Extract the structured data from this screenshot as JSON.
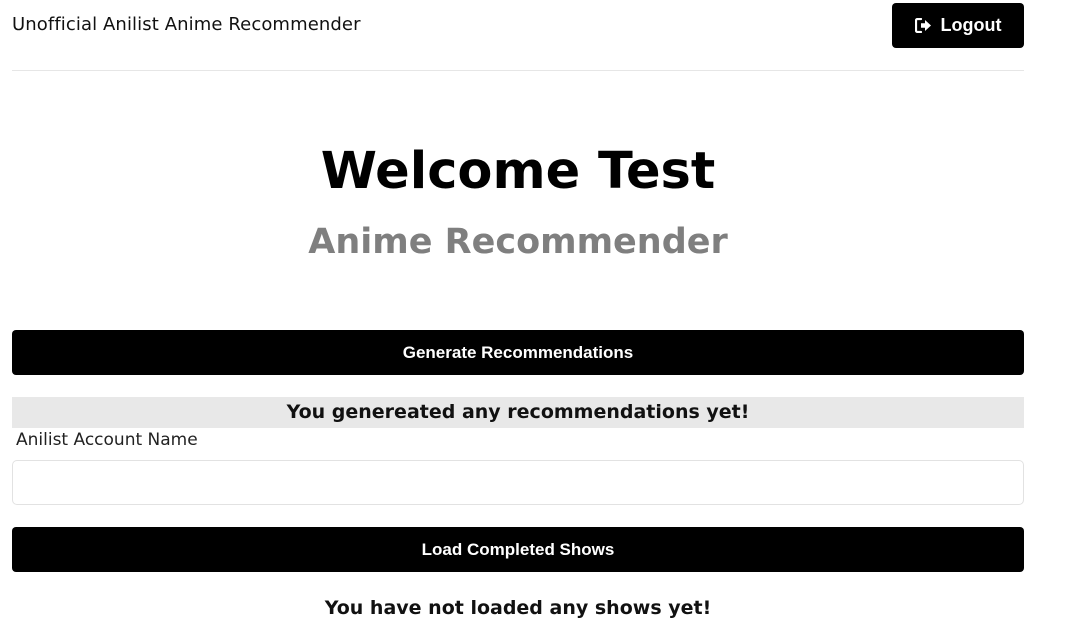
{
  "header": {
    "brand": "Unofficial Anilist Anime Recommender",
    "logout_label": "Logout",
    "logout_icon": "sign-out-icon"
  },
  "hero": {
    "welcome": "Welcome Test",
    "subtitle": "Anime Recommender"
  },
  "recommendations": {
    "generate_label": "Generate Recommendations",
    "status": "You genereated any recommendations yet!"
  },
  "account": {
    "label": "Anilist Account Name",
    "value": "",
    "placeholder": "",
    "load_label": "Load Completed Shows",
    "status": "You have not loaded any shows yet!"
  },
  "colors": {
    "primary": "#000000",
    "subtitle": "#7f7f7f",
    "status_bg": "#e8e8e8"
  }
}
